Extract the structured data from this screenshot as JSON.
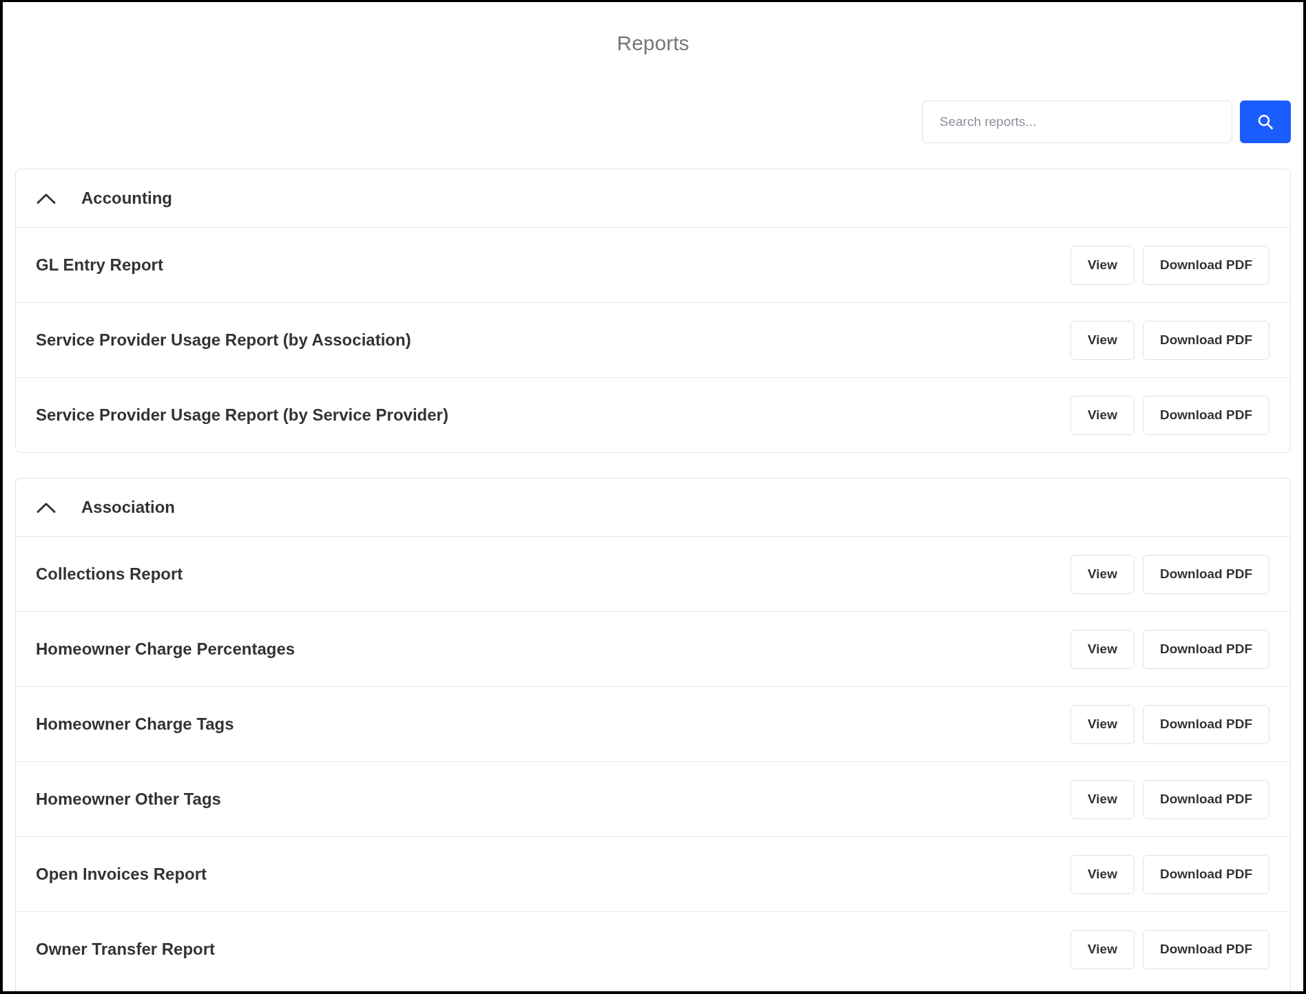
{
  "page": {
    "title": "Reports"
  },
  "search": {
    "placeholder": "Search reports..."
  },
  "groups": [
    {
      "title": "Accounting",
      "expanded": true,
      "reports": [
        {
          "name": "GL Entry Report",
          "actions": [
            "View",
            "Download PDF"
          ]
        },
        {
          "name": "Service Provider Usage Report (by Association)",
          "actions": [
            "View",
            "Download PDF"
          ]
        },
        {
          "name": "Service Provider Usage Report (by Service Provider)",
          "actions": [
            "View",
            "Download PDF"
          ]
        }
      ]
    },
    {
      "title": "Association",
      "expanded": true,
      "reports": [
        {
          "name": "Collections Report",
          "actions": [
            "View",
            "Download PDF"
          ]
        },
        {
          "name": "Homeowner Charge Percentages",
          "actions": [
            "View",
            "Download PDF"
          ]
        },
        {
          "name": "Homeowner Charge Tags",
          "actions": [
            "View",
            "Download PDF"
          ]
        },
        {
          "name": "Homeowner Other Tags",
          "actions": [
            "View",
            "Download PDF"
          ]
        },
        {
          "name": "Open Invoices Report",
          "actions": [
            "View",
            "Download PDF"
          ]
        },
        {
          "name": "Owner Transfer Report",
          "actions": [
            "View",
            "Download PDF"
          ]
        }
      ]
    }
  ]
}
